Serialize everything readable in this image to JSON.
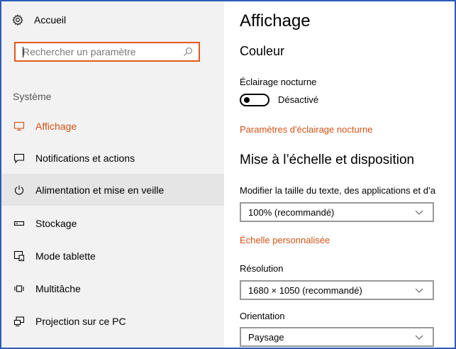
{
  "sidebar": {
    "home_label": "Accueil",
    "search_placeholder": "Rechercher un paramètre",
    "section_label": "Système",
    "items": [
      {
        "label": "Affichage",
        "icon": "monitor-icon"
      },
      {
        "label": "Notifications et actions",
        "icon": "message-icon"
      },
      {
        "label": "Alimentation et mise en veille",
        "icon": "power-icon"
      },
      {
        "label": "Stockage",
        "icon": "storage-icon"
      },
      {
        "label": "Mode tablette",
        "icon": "tablet-mode-icon"
      },
      {
        "label": "Multitâche",
        "icon": "multitask-icon"
      },
      {
        "label": "Projection sur ce PC",
        "icon": "projection-icon"
      }
    ]
  },
  "main": {
    "title": "Affichage",
    "color_section": "Couleur",
    "night_light_label": "Éclairage nocturne",
    "night_light_state": "Désactivé",
    "night_light_settings_link": "Paramètres d'éclairage nocturne",
    "scale_section": "Mise à l’échelle et disposition",
    "scale_label": "Modifier la taille du texte, des applications et d’a",
    "scale_value": "100% (recommandé)",
    "custom_scale_link": "Échelle personnalisée",
    "resolution_label": "Résolution",
    "resolution_value": "1680 × 1050 (recommandé)",
    "orientation_label": "Orientation",
    "orientation_value": "Paysage"
  },
  "colors": {
    "accent": "#d25215",
    "search_border": "#e05a1c",
    "frame": "#2b5db8"
  }
}
